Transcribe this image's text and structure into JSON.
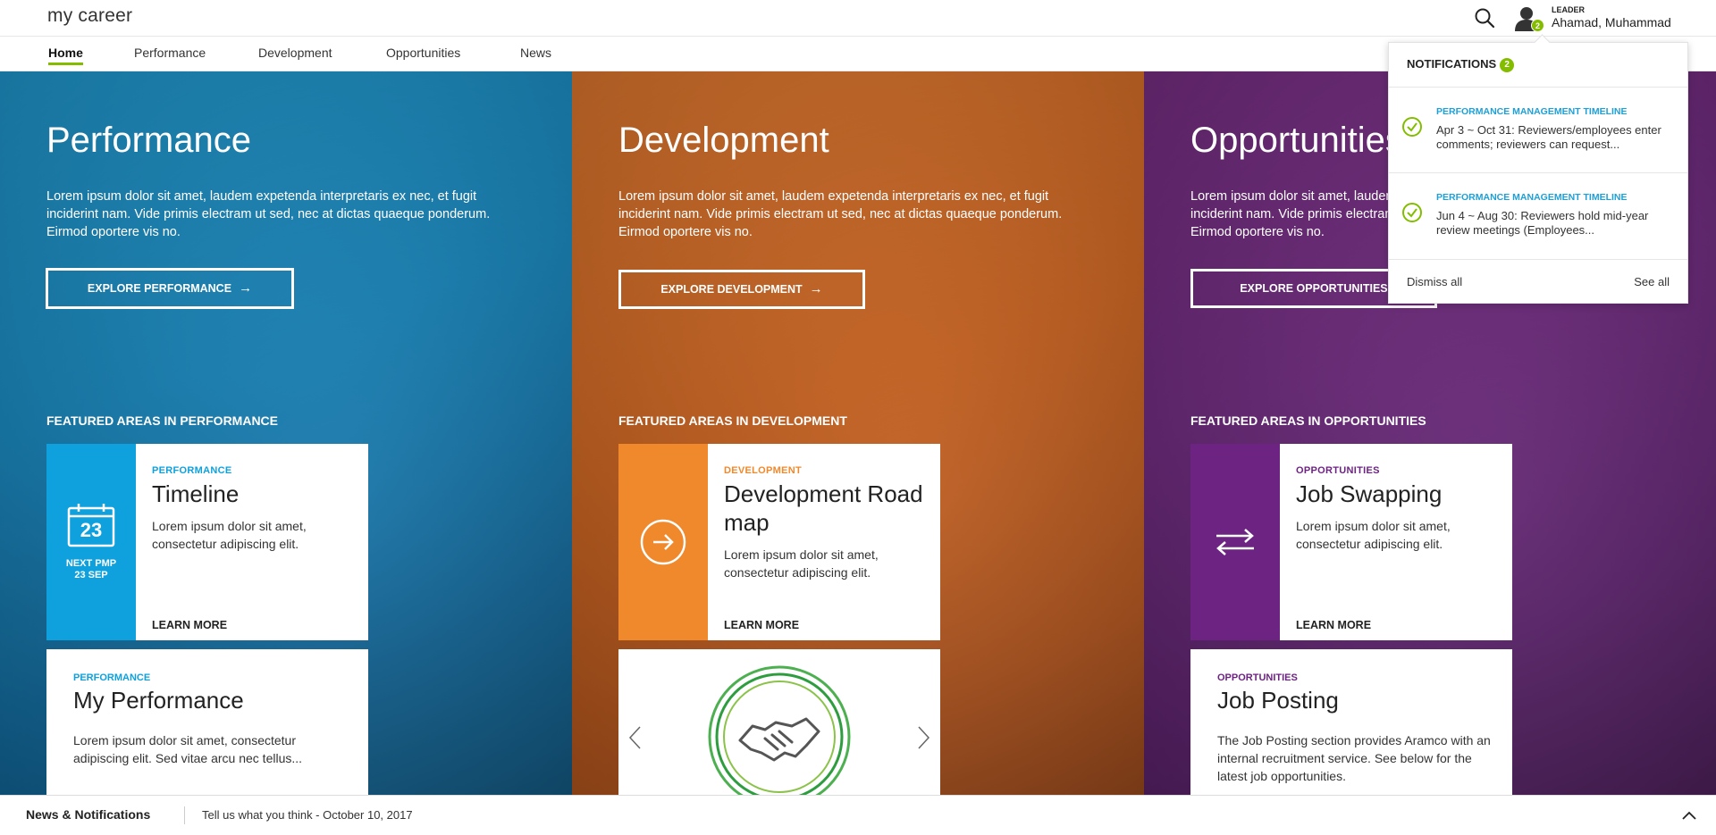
{
  "header": {
    "brand": "my career",
    "user_role": "LEADER",
    "user_name": "Ahamad, Muhammad",
    "avatar_badge": "2"
  },
  "nav": {
    "items": [
      {
        "label": "Home",
        "active": true
      },
      {
        "label": "Performance",
        "active": false
      },
      {
        "label": "Development",
        "active": false
      },
      {
        "label": "Opportunities",
        "active": false
      },
      {
        "label": "News",
        "active": false
      }
    ]
  },
  "panels": {
    "performance": {
      "title": "Performance",
      "description": "Lorem ipsum dolor sit amet, laudem expetenda interpretaris ex nec, et fugit inciderint nam. Vide primis electram ut sed, nec at dictas quaeque ponderum. Eirmod oportere vis no.",
      "button": "EXPLORE PERFORMANCE",
      "featured_heading": "FEATURED AREAS IN PERFORMANCE",
      "card": {
        "eyebrow": "PERFORMANCE",
        "title": "Timeline",
        "text": "Lorem ipsum dolor sit amet, consectetur adipiscing elit.",
        "learn_more": "LEARN MORE",
        "calendar_day": "23",
        "side_caption_1": "NEXT PMP",
        "side_caption_2": "23 SEP"
      },
      "card2": {
        "eyebrow": "PERFORMANCE",
        "title": "My Performance",
        "text": "Lorem ipsum dolor sit amet, consectetur adipiscing elit. Sed vitae arcu nec tellus..."
      }
    },
    "development": {
      "title": "Development",
      "description": "Lorem ipsum dolor sit amet, laudem expetenda interpretaris ex nec, et fugit inciderint nam. Vide primis electram ut sed, nec at dictas quaeque ponderum. Eirmod oportere vis no.",
      "button": "EXPLORE DEVELOPMENT",
      "featured_heading": "FEATURED AREAS IN DEVELOPMENT",
      "card": {
        "eyebrow": "DEVELOPMENT",
        "title": "Development Road map",
        "text": "Lorem ipsum dolor sit amet, consectetur adipiscing elit.",
        "learn_more": "LEARN MORE"
      }
    },
    "opportunities": {
      "title": "Opportunities",
      "description": "Lorem ipsum dolor sit amet, laudem expetenda interpretaris ex nec, et fugit inciderint nam. Vide primis electram ut sed, nec at dictas quaeque ponderum. Eirmod oportere vis no.",
      "button": "EXPLORE OPPORTUNITIES",
      "featured_heading": "FEATURED AREAS IN OPPORTUNITIES",
      "card": {
        "eyebrow": "OPPORTUNITIES",
        "title": "Job Swapping",
        "text": "Lorem ipsum dolor sit amet, consectetur adipiscing elit.",
        "learn_more": "LEARN MORE"
      },
      "card2": {
        "eyebrow": "OPPORTUNITIES",
        "title": "Job Posting",
        "text": "The Job Posting section provides Aramco with an internal recruitment service. See below for the latest job opportunities."
      }
    }
  },
  "notifications": {
    "heading": "NOTIFICATIONS",
    "count": "2",
    "items": [
      {
        "title": "PERFORMANCE MANAGEMENT TIMELINE",
        "text": "Apr 3 ~ Oct 31: Reviewers/employees enter comments; reviewers can request..."
      },
      {
        "title": "PERFORMANCE MANAGEMENT TIMELINE",
        "text": "Jun 4 ~ Aug 30: Reviewers hold mid-year review meetings (Employees..."
      }
    ],
    "dismiss_all": "Dismiss all",
    "see_all": "See all"
  },
  "footer": {
    "title": "News & Notifications",
    "text": "Tell us what you think - October 10, 2017"
  },
  "colors": {
    "performance": "#0ea1dd",
    "development": "#f0892b",
    "opportunities": "#6d2382",
    "accent_green": "#84bd00",
    "notif_title": "#1ea0d6"
  },
  "icons": {
    "search": "search-icon",
    "avatar": "user-icon",
    "calendar": "calendar-icon",
    "roadmap": "arrow-circle-icon",
    "swap": "swap-arrows-icon",
    "check": "check-circle-icon",
    "handshake": "handshake-icon",
    "chevron_up": "chevron-up-icon"
  }
}
